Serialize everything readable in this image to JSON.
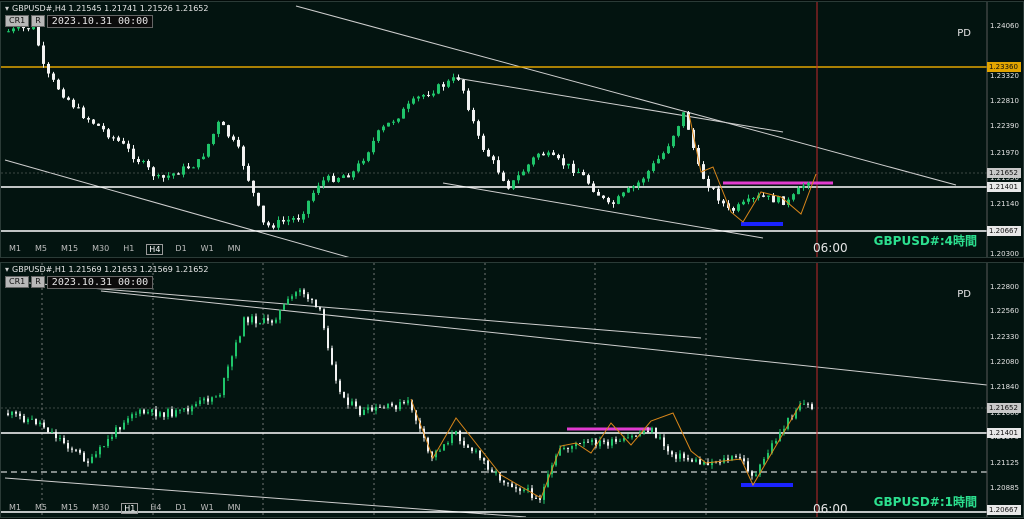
{
  "top": {
    "symbol_header": "GBPUSD#,H4  1.21545 1.21741 1.21526 1.21652",
    "cr_label": "CR1",
    "r_label": "R",
    "datetime": "2023.10.31 00:00",
    "pd_label": "PD",
    "timeframes": [
      "M1",
      "M5",
      "M15",
      "M30",
      "H1",
      "H4",
      "D1",
      "W1",
      "MN"
    ],
    "selected_tf": "H4",
    "chart_title": "GBPUSD#:4時間",
    "time_label": "06:00",
    "price_axis": [
      "1.24060",
      "1.23320",
      "1.22810",
      "1.22390",
      "1.21970",
      "1.21550",
      "1.21140",
      "1.20300"
    ],
    "line_prices": {
      "gold": "1.23360",
      "current": "1.21652",
      "white": "1.21401",
      "support": "1.20667"
    },
    "colors": {
      "gold": "#e2a400",
      "magenta": "#e23bd0",
      "blue": "#1a23ff",
      "bull": "#1fc46a",
      "bear": "#f2f2f2",
      "vline": "#c1272d"
    }
  },
  "bottom": {
    "symbol_header": "GBPUSD#,H1  1.21569 1.21653 1.21569 1.21652",
    "cr_label": "CR1",
    "r_label": "R",
    "datetime": "2023.10.31 00:00",
    "pd_label": "PD",
    "timeframes": [
      "M1",
      "M5",
      "M15",
      "M30",
      "H1",
      "H4",
      "D1",
      "W1",
      "MN"
    ],
    "selected_tf": "H1",
    "chart_title": "GBPUSD#:1時間",
    "time_label": "06:00",
    "price_axis": [
      "1.22800",
      "1.22560",
      "1.22330",
      "1.22080",
      "1.21840",
      "1.21600",
      "1.21370",
      "1.21125",
      "1.20885"
    ],
    "line_prices": {
      "current": "1.21652",
      "white": "1.21401",
      "support": "1.20667"
    },
    "colors": {
      "magenta": "#e23bd0",
      "blue": "#1a23ff",
      "bull": "#1fc46a",
      "bear": "#f2f2f2",
      "orange": "#d9861a",
      "vline": "#c1272d"
    }
  }
}
